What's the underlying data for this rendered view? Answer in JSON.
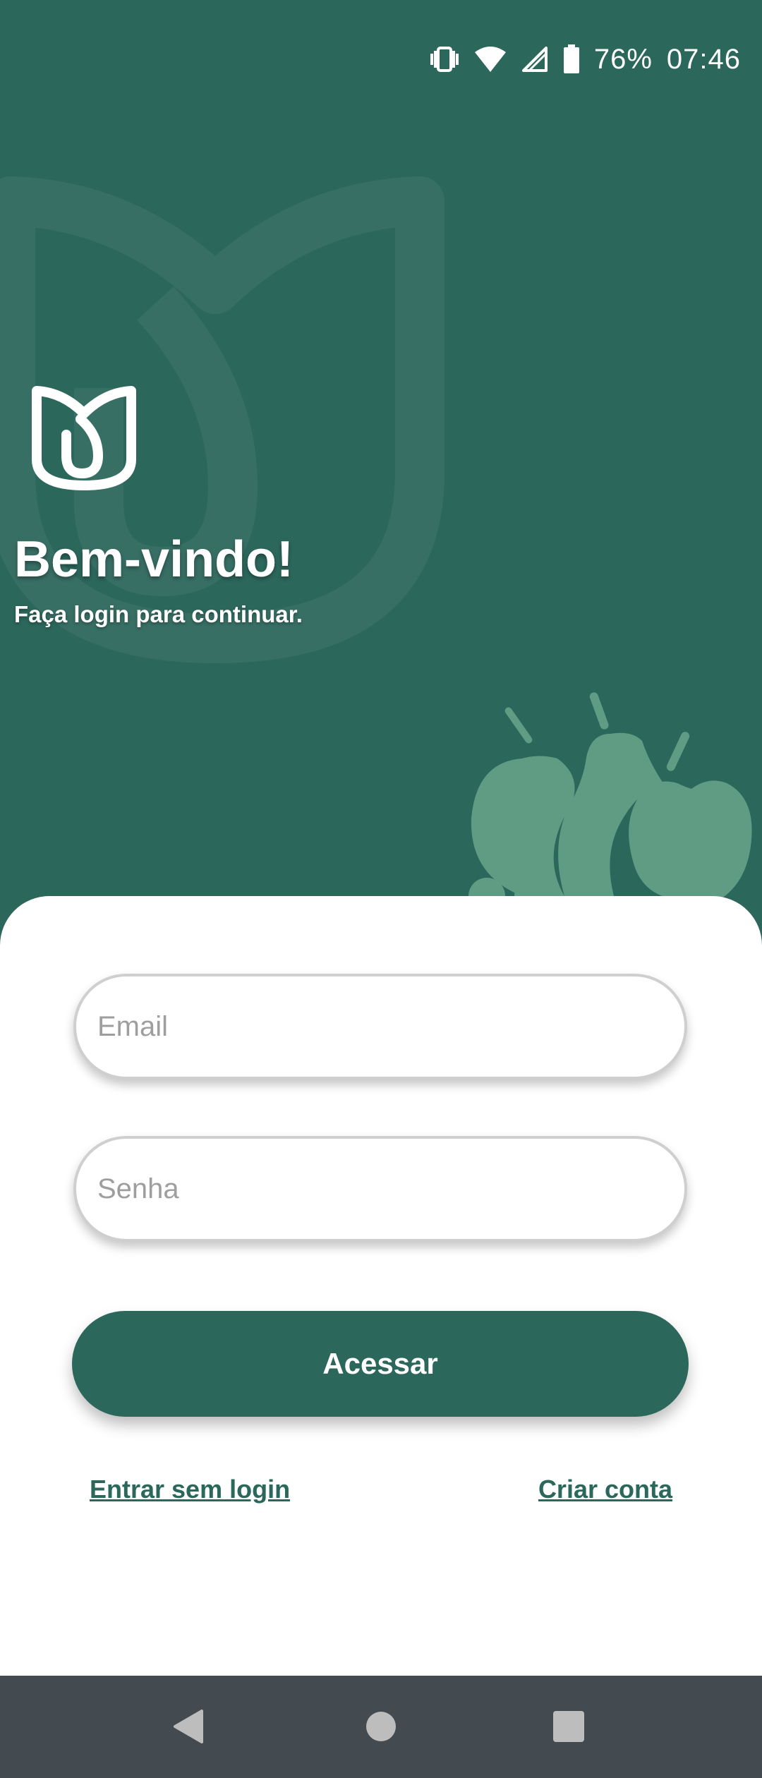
{
  "status_bar": {
    "battery": "76%",
    "time": "07:46",
    "icons": [
      "vibrate-icon",
      "wifi-icon",
      "signal-icon",
      "battery-icon"
    ]
  },
  "header": {
    "title": "Bem-vindo!",
    "subtitle": "Faça login para continuar."
  },
  "form": {
    "email_placeholder": "Email",
    "email_value": "",
    "password_placeholder": "Senha",
    "password_value": "",
    "submit_label": "Acessar"
  },
  "links": {
    "guest": "Entrar sem login",
    "signup": "Criar conta"
  },
  "nav_bar": {
    "icons": [
      "back-icon",
      "home-icon",
      "recents-icon"
    ]
  },
  "colors": {
    "primary": "#2c675c",
    "fruit": "#5f9c83",
    "nav_bar": "#434b50",
    "card": "#ffffff",
    "field_border": "#cfcfcf",
    "placeholder": "#9e9e9e"
  }
}
